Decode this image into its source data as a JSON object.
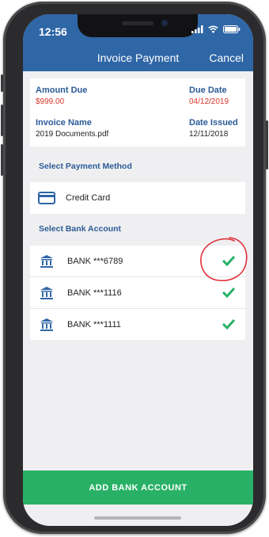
{
  "status_bar": {
    "time": "12:56"
  },
  "nav": {
    "title": "Invoice Payment",
    "cancel_label": "Cancel"
  },
  "invoice": {
    "amount_due_label": "Amount Due",
    "amount_due": "$999.00",
    "due_date_label": "Due Date",
    "due_date": "04/12/2019",
    "invoice_name_label": "Invoice Name",
    "invoice_name": "2019 Documents.pdf",
    "date_issued_label": "Date Issued",
    "date_issued": "12/11/2018"
  },
  "payment_method": {
    "section_label": "Select Payment Method",
    "selected": "Credit Card"
  },
  "bank_accounts": {
    "section_label": "Select Bank Account",
    "items": [
      {
        "name": "BANK ***6789",
        "checked": true
      },
      {
        "name": "BANK ***1116",
        "checked": true
      },
      {
        "name": "BANK ***1111",
        "checked": true
      }
    ]
  },
  "add_bank_button": "ADD BANK ACCOUNT",
  "colors": {
    "header": "#2f66a6",
    "label_blue": "#2b5b97",
    "due_red": "#d9342b",
    "check_green": "#28b166",
    "annotation_red": "#e0323c",
    "button_green": "#28b166"
  },
  "icons": {
    "status": [
      "signal-icon",
      "wifi-icon",
      "battery-icon"
    ],
    "payment_method": "credit-card-icon",
    "bank": "bank-icon",
    "selected": "check-icon"
  }
}
